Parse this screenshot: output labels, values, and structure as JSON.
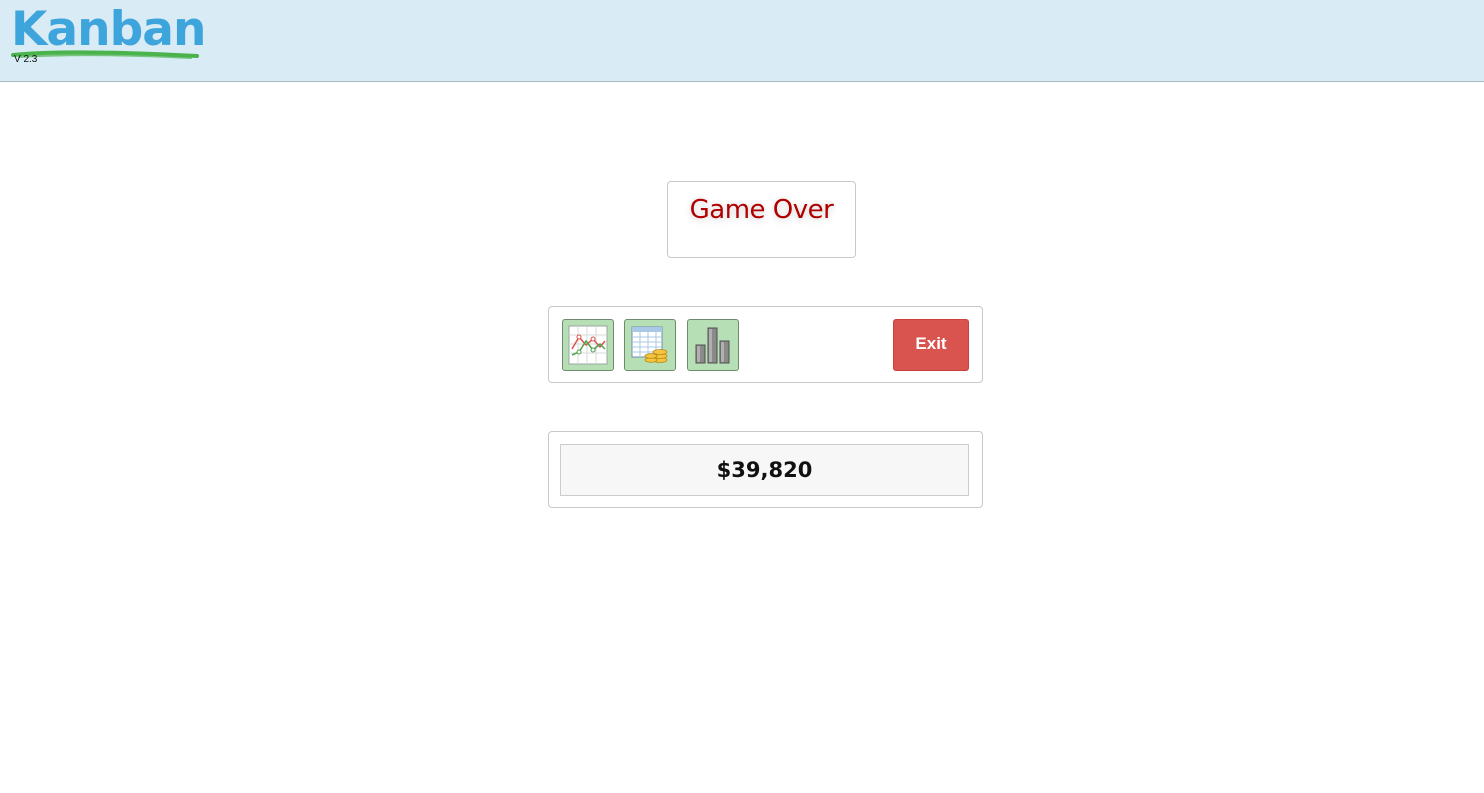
{
  "header": {
    "logo_text": "Kanban",
    "version": "V 2.3",
    "background": "#d9ecf6",
    "logo_color": "#3ea4dc",
    "swoosh_color": "#4bb34b"
  },
  "title_panel": {
    "title": "Game Over",
    "title_color": "#b00000"
  },
  "toolbar": {
    "buttons": [
      {
        "icon": "line-chart-icon"
      },
      {
        "icon": "spreadsheet-coins-icon"
      },
      {
        "icon": "bar-chart-icon"
      }
    ],
    "exit_label": "Exit",
    "exit_color": "#d9534f"
  },
  "score_panel": {
    "score": "$39,820"
  }
}
